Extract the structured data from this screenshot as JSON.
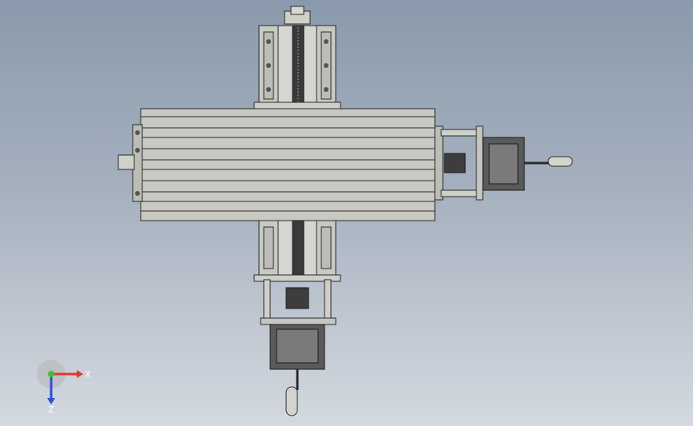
{
  "viewport": {
    "background_top": "#8a9aac",
    "background_bottom": "#d4d9e0",
    "part_color": "#c9c9c4",
    "edge_color": "#2a2a2a"
  },
  "triad": {
    "x_label": "X",
    "z_label": "Z",
    "x_color": "#e8332a",
    "y_color": "#3ac23a",
    "z_color": "#2f4fd6"
  },
  "parts": {
    "x_axis_beam": "horizontal-aluminum-profile",
    "y_axis_slide": "vertical-linear-slide",
    "x_motor": "stepper-motor-right",
    "y_motor": "stepper-motor-bottom",
    "x_handwheel": "handwheel-right",
    "y_handwheel": "handwheel-bottom"
  }
}
